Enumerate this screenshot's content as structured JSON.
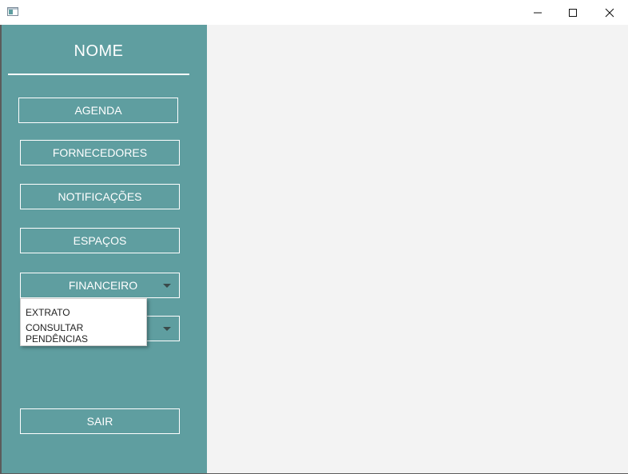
{
  "window": {
    "icon": "app-window-icon",
    "controls": [
      "minimize-icon",
      "maximize-icon",
      "close-icon"
    ]
  },
  "sidebar": {
    "name": "NOME",
    "buttons": {
      "agenda": "AGENDA",
      "fornecedores": "FORNECEDORES",
      "notificacoes": "NOTIFICAÇÕES",
      "espacos": "ESPAÇOS",
      "financeiro": "FINANCEIRO",
      "sair": "SAIR"
    }
  },
  "financeiro_menu": {
    "items": [
      "EXTRATO",
      "CONSULTAR PENDÊNCIAS"
    ]
  },
  "colors": {
    "sidebar": "#5f9ea0",
    "main_background": "#f3f3f3",
    "titlebar": "#ffffff"
  }
}
